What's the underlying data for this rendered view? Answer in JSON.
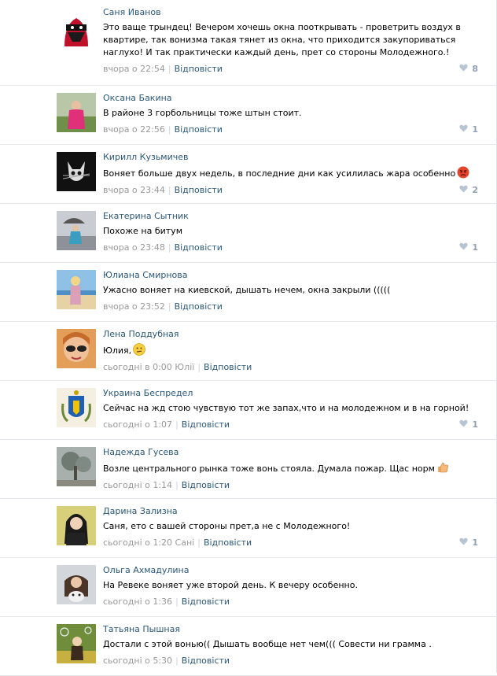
{
  "comments": [
    {
      "author": "Саня Иванов",
      "text": "Это ваще трындец! Вечером хочешь окна поотк­рывать - проветрить воздух в квартире, так вонизма такая тянет из окна, что приходится закупориваться наглухо! И так практически каждый день, прет со стороны Молодежного.!",
      "time": "вчора о 22:54",
      "reply": "Відповісти",
      "likes": "8",
      "avatar": "masked-person"
    },
    {
      "author": "Оксана Бакина",
      "text": "В районе 3 горбольницы тоже штын стоит.",
      "time": "вчора о 22:56",
      "reply": "Відповісти",
      "likes": "1",
      "avatar": "woman-pink"
    },
    {
      "author": "Кирилл Кузьмичев",
      "text": "Воняет больше двух недель, в последние дни как усилилась жара особенно",
      "emoji": "angry-face",
      "time": "вчора о 23:44",
      "reply": "Відповісти",
      "likes": "2",
      "avatar": "cat-dark"
    },
    {
      "author": "Екатерина Сытник",
      "text": "Похоже на битум",
      "time": "вчора о 23:48",
      "reply": "Відповісти",
      "likes": "1",
      "avatar": "girl-umbrella"
    },
    {
      "author": "Юлиана Смирнова",
      "text": "Ужасно воняет на киевской, дышать нечем, окна закрыли (((((",
      "time": "вчора о 23:52",
      "reply": "Відповісти",
      "likes": "",
      "avatar": "girl-beach"
    },
    {
      "author": "Лена Поддубная",
      "text": "Юлия,",
      "emoji": "confused-face",
      "time": "сьогодні в 0:00 Юлії",
      "reply": "Відповісти",
      "likes": "",
      "avatar": "woman-glasses"
    },
    {
      "author": "Украина Беспредел",
      "text": "Сейчас на жд стою чувствую тот же запах,что и на молодежном и в на горной!",
      "time": "сьогодні о 1:07",
      "reply": "Відповісти",
      "likes": "1",
      "avatar": "coat-of-arms"
    },
    {
      "author": "Надежда Гусева",
      "text": "Возле центрального рынка тоже вонь стояла. Думала пожар. Щас норм",
      "emoji": "thumbs-up",
      "time": "сьогодні о 1:14",
      "reply": "Відповісти",
      "likes": "",
      "avatar": "tree-gray"
    },
    {
      "author": "Дарина Зализна",
      "text": "Саня, ето с вашей стороны прет,а не с Молодежного!",
      "time": "сьогодні о 1:20 Сані",
      "reply": "Відповісти",
      "likes": "1",
      "avatar": "woman-dark-hair"
    },
    {
      "author": "Ольга Ахмадулина",
      "text": "На Ревеке воняет уже второй день. К вечеру особенно.",
      "time": "сьогодні о 1:36",
      "reply": "Відповісти",
      "likes": "",
      "avatar": "woman-dog"
    },
    {
      "author": "Татьяна Пышная",
      "text": "Достали с этой вонью(( Дышать вообще нет чем((( Совести ни грамма .",
      "time": "сьогодні о 5:30",
      "reply": "Відповісти",
      "likes": "",
      "avatar": "girl-bubbles"
    }
  ],
  "colors": {
    "link": "#2b587a",
    "meta": "#999999",
    "divider": "#e4e8ed",
    "likes": "#8fa1b3"
  }
}
